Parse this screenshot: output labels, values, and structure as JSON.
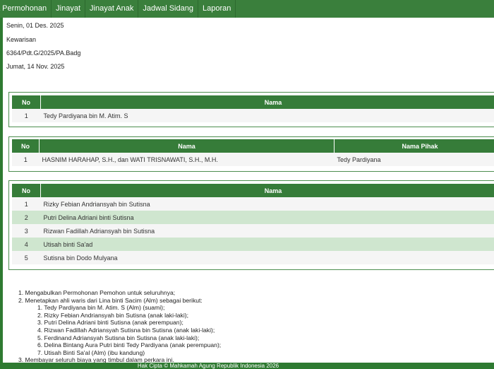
{
  "nav": [
    "a Permohonan",
    "Jinayat",
    "Jinayat Anak",
    "Jadwal Sidang",
    "Laporan"
  ],
  "info": {
    "date": "Senin, 01 Des. 2025",
    "category": "Kewarisan",
    "case_number": "6364/Pdt.G/2025/PA.Badg",
    "decision_date": "Jumat, 14 Nov. 2025"
  },
  "table1": {
    "headers": [
      "No",
      "Nama"
    ],
    "rows": [
      [
        "1",
        "Tedy Pardiyana bin M. Atim. S"
      ]
    ]
  },
  "table2": {
    "headers": [
      "No",
      "Nama",
      "Nama Pihak"
    ],
    "rows": [
      [
        "1",
        "HASNIM HARAHAP, S.H., dan WATI TRISNAWATI, S.H., M.H.",
        "Tedy Pardiyana"
      ]
    ]
  },
  "table3": {
    "headers": [
      "No",
      "Nama"
    ],
    "rows": [
      [
        "1",
        "Rizky Febian Andriansyah bin Sutisna"
      ],
      [
        "2",
        "Putri Delina Adriani binti Sutisna"
      ],
      [
        "3",
        "Rizwan Fadillah Adriansyah bin Sutisna"
      ],
      [
        "4",
        "Utisah binti Sa'ad"
      ],
      [
        "5",
        "Sutisna bin Dodo Mulyana"
      ]
    ]
  },
  "decision": {
    "items": [
      "1. Mengabulkan Permohonan Pemohon untuk seluruhnya;",
      "2. Menetapkan ahli waris dari Lina binti Sacim (Alm) sebagai berikut:"
    ],
    "heirs": [
      "1. Tedy Pardiyana bin M. Atim. S (Alm) (suami);",
      "2. Rizky Febian Andriansyah bin Sutisna (anak laki-laki);",
      "3. Putri Delina Adriani binti Sutisna (anak perempuan);",
      "4. Rizwan Fadillah Adriansyah Sutisna bin Sutisna (anak laki-laki);",
      "5. Ferdinand Adriansyah Sutisna bin Sutisna (anak laki-laki);",
      "6. Delina Bintang Aura Putri binti Tedy Pardiyana (anak perempuan);",
      "7. Utisah Binti Sa'al (Alm) (ibu kandung)"
    ],
    "last": "3. Membayar seluruh biaya yang timbul dalam perkara ini."
  },
  "footer": "Hak Cipta © Mahkamah Agung Republik Indonesia 2026"
}
